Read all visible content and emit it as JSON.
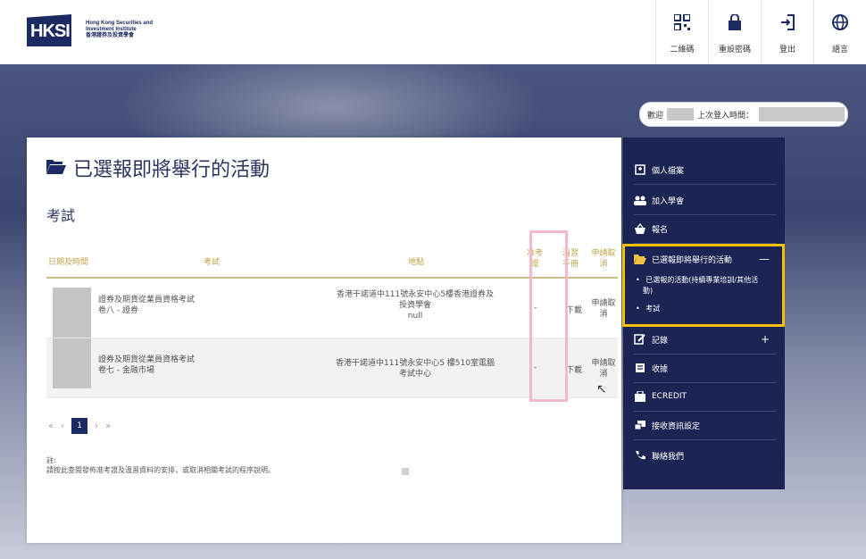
{
  "header": {
    "logo_text": "HKSI",
    "logo_en": "Hong Kong Securities and Investment Institute",
    "logo_zh": "香港證券及投資學會",
    "nav": [
      {
        "label": "二維碼",
        "icon": "qr-code-icon"
      },
      {
        "label": "重設密碼",
        "icon": "lock-icon"
      },
      {
        "label": "登出",
        "icon": "logout-icon"
      },
      {
        "label": "語言",
        "icon": "globe-icon"
      }
    ]
  },
  "login": {
    "welcome": "歡迎",
    "last_login_label": "上次登入時間："
  },
  "panel": {
    "title": "已選報即將舉行的活動",
    "section": "考試",
    "columns": {
      "datetime": "日期及時間",
      "exam": "考試",
      "location": "地點",
      "admission": "准考證",
      "handbook": "溫習手冊",
      "cancel": "申請取消"
    },
    "rows": [
      {
        "exam_line1": "證券及期貨從業員資格考試",
        "exam_line2": "卷八 - 證券",
        "location_line1": "香港干諾道中111號永安中心5樓香港證券及",
        "location_line2": "投資學會",
        "location_line3": "null",
        "admission": "-",
        "handbook": "下載",
        "cancel_line1": "申請取",
        "cancel_line2": "消"
      },
      {
        "exam_line1": "證券及期貨從業員資格考試",
        "exam_line2": "卷七 - 金融市場",
        "location_line1": "香港干諾道中111號永安中心5 樓510室電腦",
        "location_line2": "考試中心",
        "location_line3": "",
        "admission": "-",
        "handbook": "下載",
        "cancel_line1": "申請取",
        "cancel_line2": "消"
      }
    ],
    "pager": {
      "first": "«",
      "prev": "‹",
      "current": "1",
      "next": "›",
      "last": "»"
    },
    "note_label": "註:",
    "note_text": "請按此查閱發佈准考證及溫習資料的安排，或取消相關考試的程序說明。"
  },
  "sidebar": {
    "items": [
      {
        "label": "個人檔案",
        "icon": "profile-icon"
      },
      {
        "label": "加入學會",
        "icon": "members-icon"
      },
      {
        "label": "報名",
        "icon": "basket-icon"
      },
      {
        "label": "已選報即將舉行的活動",
        "icon": "folder-icon",
        "toggle": "—"
      },
      {
        "label": "記錄",
        "icon": "edit-icon",
        "toggle": "+"
      },
      {
        "label": "收據",
        "icon": "receipt-icon"
      },
      {
        "label": "ECREDIT",
        "icon": "credit-icon"
      },
      {
        "label": "接收資訊設定",
        "icon": "settings-icon"
      },
      {
        "label": "聯絡我們",
        "icon": "phone-icon"
      }
    ],
    "subitems": [
      {
        "line1": "已選報的活動(持續專業培訓/其他活",
        "line2": "動)"
      },
      {
        "line1": "考試",
        "line2": ""
      }
    ]
  },
  "colors": {
    "navy": "#1c2454",
    "gold_header": "#c0a14a",
    "highlight_yellow": "#f5c000",
    "highlight_pink": "#f4b8cd"
  }
}
